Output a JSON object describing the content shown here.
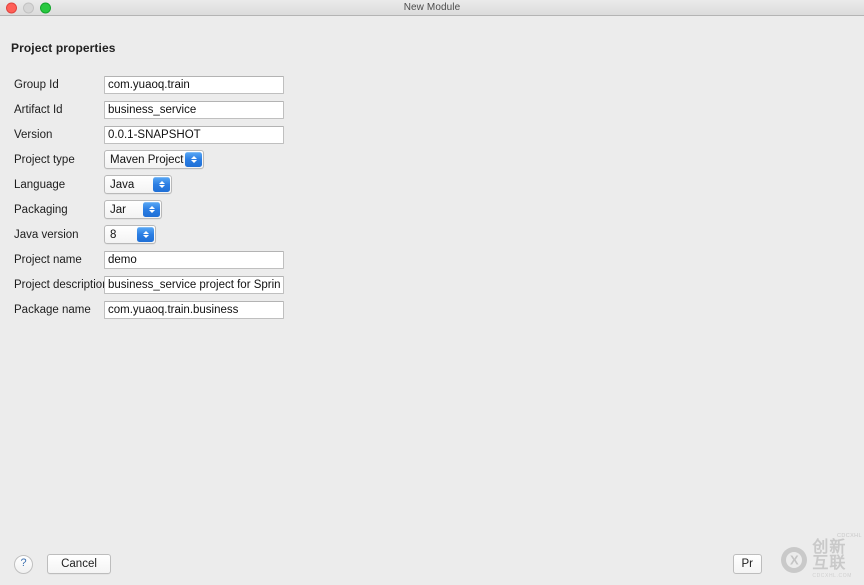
{
  "window": {
    "title": "New Module",
    "traffic_lights": {
      "close": "close-button",
      "minimize": "minimize-button",
      "zoom": "zoom-button"
    }
  },
  "content": {
    "section_title": "Project properties",
    "fields": [
      {
        "label": "Group Id",
        "value": "com.yuaoq.train",
        "type": "text"
      },
      {
        "label": "Artifact Id",
        "value": "business_service",
        "type": "text"
      },
      {
        "label": "Version",
        "value": "0.0.1-SNAPSHOT",
        "type": "text"
      },
      {
        "label": "Project type",
        "value": "Maven Project",
        "type": "popup"
      },
      {
        "label": "Language",
        "value": "Java",
        "type": "popup"
      },
      {
        "label": "Packaging",
        "value": "Jar",
        "type": "popup"
      },
      {
        "label": "Java version",
        "value": "8",
        "type": "popup"
      },
      {
        "label": "Project name",
        "value": "demo",
        "type": "text"
      },
      {
        "label": "Project description",
        "value": "business_service project for Spring",
        "type": "text"
      },
      {
        "label": "Package name",
        "value": "com.yuaoq.train.business",
        "type": "text"
      }
    ]
  },
  "footer": {
    "help_label": "?",
    "cancel_label": "Cancel",
    "previous_label": "Pr"
  },
  "watermark": {
    "mark": "X",
    "cn_text": "创新互联",
    "en_text": "CDCXHL.COM",
    "side_text": "CDCXHL"
  },
  "colors": {
    "window_background": "#ececec",
    "titlebar_top": "#ebebeb",
    "titlebar_bottom": "#dcdcdc",
    "field_background": "#ffffff",
    "field_border": "#bfbfbf",
    "stepper_blue": "#2b7ee3",
    "close_red": "#ff5f57",
    "minimize_gray": "#d6d6d6",
    "zoom_green": "#28c840",
    "label_text": "#1d1d1d",
    "title_text": "#4c4c4c",
    "help_blue": "#3b6fb0"
  }
}
